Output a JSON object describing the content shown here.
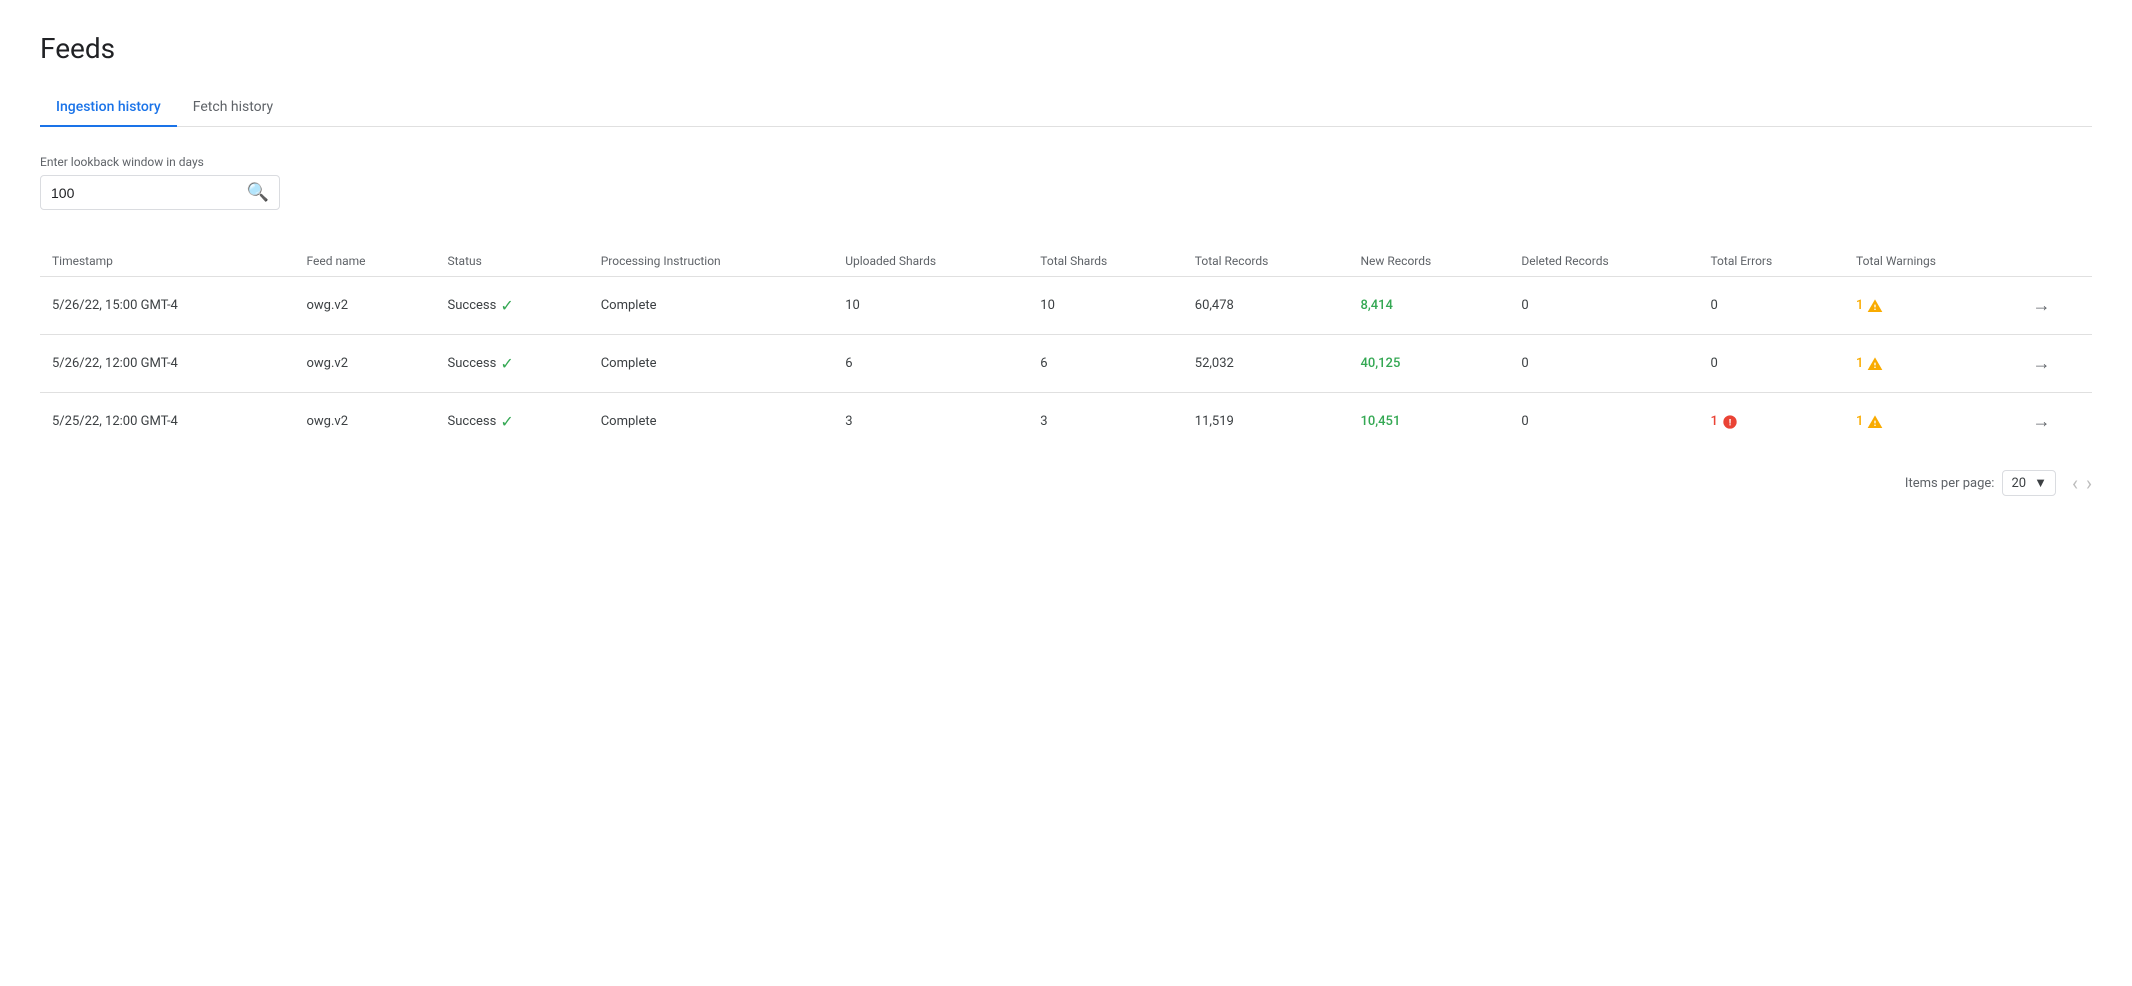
{
  "page": {
    "title": "Feeds"
  },
  "tabs": [
    {
      "id": "ingestion-history",
      "label": "Ingestion history",
      "active": true
    },
    {
      "id": "fetch-history",
      "label": "Fetch history",
      "active": false
    }
  ],
  "lookback": {
    "label": "Enter lookback window in days",
    "value": "100"
  },
  "table": {
    "columns": [
      {
        "id": "timestamp",
        "label": "Timestamp"
      },
      {
        "id": "feed-name",
        "label": "Feed name"
      },
      {
        "id": "status",
        "label": "Status"
      },
      {
        "id": "processing-instruction",
        "label": "Processing Instruction"
      },
      {
        "id": "uploaded-shards",
        "label": "Uploaded Shards"
      },
      {
        "id": "total-shards",
        "label": "Total Shards"
      },
      {
        "id": "total-records",
        "label": "Total Records"
      },
      {
        "id": "new-records",
        "label": "New Records"
      },
      {
        "id": "deleted-records",
        "label": "Deleted Records"
      },
      {
        "id": "total-errors",
        "label": "Total Errors"
      },
      {
        "id": "total-warnings",
        "label": "Total Warnings"
      },
      {
        "id": "action",
        "label": ""
      }
    ],
    "rows": [
      {
        "timestamp": "5/26/22, 15:00 GMT-4",
        "feed_name": "owg.v2",
        "status": "Success",
        "processing_instruction": "Complete",
        "uploaded_shards": "10",
        "total_shards": "10",
        "total_records": "60,478",
        "new_records": "8,414",
        "deleted_records": "0",
        "total_errors": "0",
        "total_warnings": "1",
        "has_warning": true,
        "has_error": false
      },
      {
        "timestamp": "5/26/22, 12:00 GMT-4",
        "feed_name": "owg.v2",
        "status": "Success",
        "processing_instruction": "Complete",
        "uploaded_shards": "6",
        "total_shards": "6",
        "total_records": "52,032",
        "new_records": "40,125",
        "deleted_records": "0",
        "total_errors": "0",
        "total_warnings": "1",
        "has_warning": true,
        "has_error": false
      },
      {
        "timestamp": "5/25/22, 12:00 GMT-4",
        "feed_name": "owg.v2",
        "status": "Success",
        "processing_instruction": "Complete",
        "uploaded_shards": "3",
        "total_shards": "3",
        "total_records": "11,519",
        "new_records": "10,451",
        "deleted_records": "0",
        "total_errors": "1",
        "total_warnings": "1",
        "has_warning": true,
        "has_error": true
      }
    ]
  },
  "pagination": {
    "items_per_page_label": "Items per page:",
    "items_per_page_value": "20",
    "prev_disabled": true,
    "next_disabled": true
  }
}
